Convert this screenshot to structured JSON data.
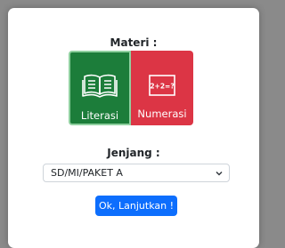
{
  "materi": {
    "label": "Materi :",
    "options": [
      {
        "label": "Literasi",
        "icon": "book-icon",
        "color": "#1c7d3a",
        "selected": true
      },
      {
        "label": "Numerasi",
        "icon": "math-board-icon",
        "color": "#dc3545",
        "board_text": "2+2=?"
      }
    ]
  },
  "jenjang": {
    "label": "Jenjang :",
    "selected": "SD/MI/PAKET A"
  },
  "submit": {
    "label": "Ok, Lanjutkan !",
    "color": "#0d6efd"
  }
}
